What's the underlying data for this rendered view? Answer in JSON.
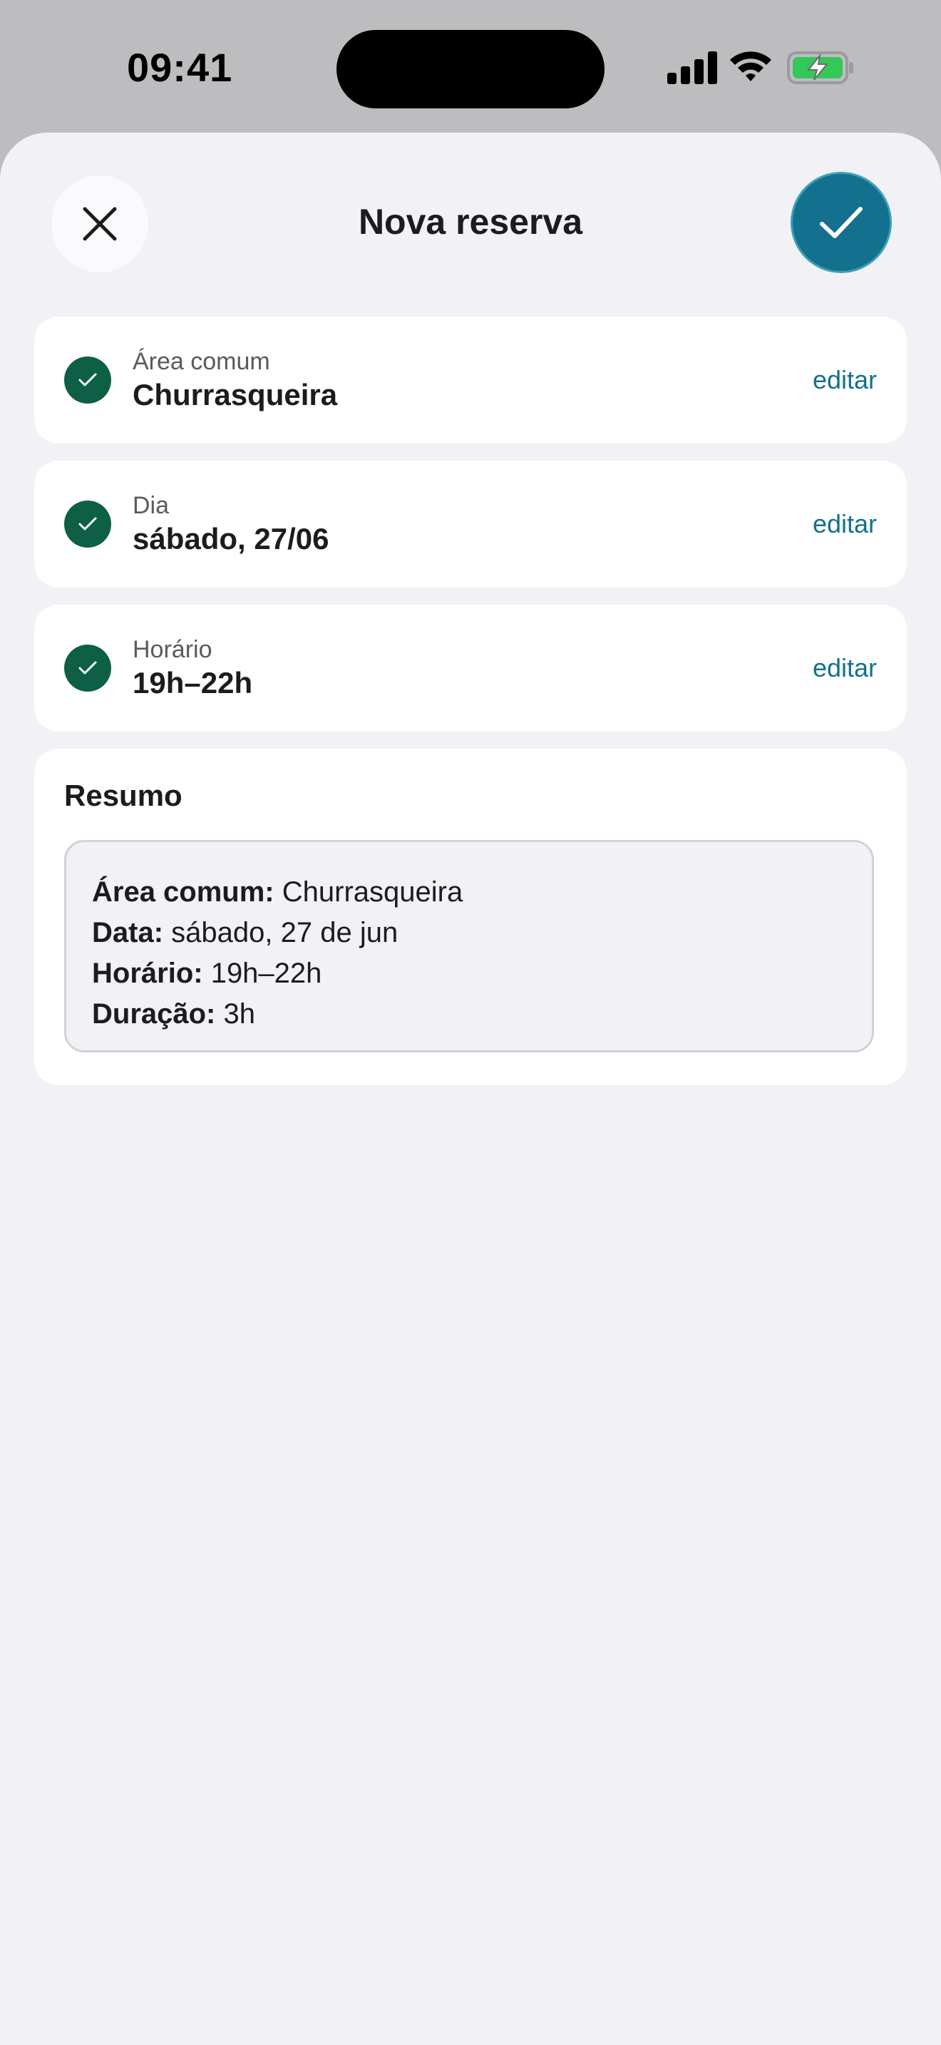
{
  "status_bar": {
    "time": "09:41"
  },
  "header": {
    "title": "Nova reserva"
  },
  "steps": [
    {
      "label": "Área comum",
      "value": "Churrasqueira",
      "edit": "editar"
    },
    {
      "label": "Dia",
      "value": "sábado, 27/06",
      "edit": "editar"
    },
    {
      "label": "Horário",
      "value": "19h–22h",
      "edit": "editar"
    }
  ],
  "summary": {
    "title": "Resumo",
    "lines": [
      {
        "key": "Área comum:",
        "value": " Churrasqueira"
      },
      {
        "key": "Data:",
        "value": " sábado, 27 de jun"
      },
      {
        "key": "Horário:",
        "value": " 19h–22h"
      },
      {
        "key": "Duração:",
        "value": " 3h"
      }
    ]
  },
  "colors": {
    "accent": "#13708f",
    "success": "#0d5f45",
    "battery": "#34c759"
  }
}
